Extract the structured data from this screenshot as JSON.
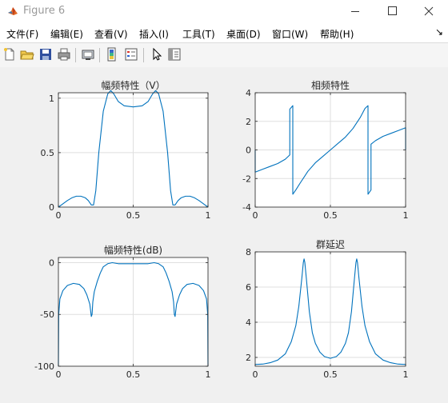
{
  "window": {
    "title": "Figure 6"
  },
  "menu": [
    "文件(F)",
    "编辑(E)",
    "查看(V)",
    "插入(I)",
    "工具(T)",
    "桌面(D)",
    "窗口(W)",
    "帮助(H)"
  ],
  "toolbar": {
    "icons": [
      "new-figure-icon",
      "open-file-icon",
      "save-icon",
      "print-icon",
      "link-plot-icon",
      "insert-colorbar-icon",
      "insert-legend-icon",
      "pointer-icon",
      "property-editor-icon"
    ]
  },
  "colors": {
    "line": "#0072bd",
    "grid": "#dfdfdf",
    "axes": "#262626"
  },
  "chart_data": [
    {
      "type": "line",
      "title": "幅频特性（V）",
      "xlim": [
        0,
        1
      ],
      "ylim": [
        0,
        1.05
      ],
      "xticks": [
        0,
        0.5,
        1
      ],
      "xtick_labels": [
        "0",
        "0.5",
        "1"
      ],
      "yticks": [
        0,
        0.5,
        1
      ],
      "ytick_labels": [
        "0",
        "0.5",
        "1"
      ],
      "grid": true,
      "x": [
        0,
        0.03,
        0.06,
        0.09,
        0.12,
        0.15,
        0.18,
        0.2,
        0.22,
        0.235,
        0.25,
        0.27,
        0.3,
        0.33,
        0.35,
        0.37,
        0.4,
        0.44,
        0.5,
        0.56,
        0.6,
        0.63,
        0.65,
        0.67,
        0.7,
        0.73,
        0.75,
        0.765,
        0.78,
        0.8,
        0.82,
        0.85,
        0.88,
        0.91,
        0.94,
        0.97,
        1
      ],
      "y": [
        0,
        0.03,
        0.06,
        0.085,
        0.1,
        0.1,
        0.085,
        0.06,
        0.02,
        0.02,
        0.15,
        0.5,
        0.88,
        1.04,
        1.07,
        1.04,
        0.97,
        0.93,
        0.92,
        0.93,
        0.97,
        1.04,
        1.07,
        1.04,
        0.88,
        0.5,
        0.15,
        0.02,
        0.02,
        0.06,
        0.085,
        0.1,
        0.1,
        0.085,
        0.06,
        0.03,
        0
      ]
    },
    {
      "type": "line",
      "title": "相频特性",
      "xlim": [
        0,
        1
      ],
      "ylim": [
        -4,
        4
      ],
      "xticks": [
        0,
        0.5,
        1
      ],
      "xtick_labels": [
        "0",
        "0.5",
        "1"
      ],
      "yticks": [
        -4,
        -2,
        0,
        2,
        4
      ],
      "ytick_labels": [
        "-4",
        "-2",
        "0",
        "2",
        "4"
      ],
      "grid": true,
      "x": [
        0,
        0.0001,
        0.05,
        0.1,
        0.15,
        0.2,
        0.23,
        0.23,
        0.25,
        0.25,
        0.27,
        0.3,
        0.35,
        0.4,
        0.45,
        0.5,
        0.55,
        0.6,
        0.65,
        0.7,
        0.73,
        0.75,
        0.75,
        0.77,
        0.77,
        0.8,
        0.85,
        0.9,
        0.95,
        1,
        1
      ],
      "y": [
        0,
        -1.55,
        -1.35,
        -1.15,
        -0.95,
        -0.65,
        -0.35,
        2.85,
        3.1,
        -3.1,
        -2.8,
        -2.3,
        -1.5,
        -0.9,
        -0.45,
        0,
        0.45,
        0.9,
        1.5,
        2.3,
        2.9,
        3.1,
        -3.1,
        -2.8,
        0.4,
        0.65,
        0.95,
        1.15,
        1.35,
        1.55,
        0
      ]
    },
    {
      "type": "line",
      "title": "幅频特性(dB)",
      "xlim": [
        0,
        1
      ],
      "ylim": [
        -100,
        5
      ],
      "xticks": [
        0,
        0.5,
        1
      ],
      "xtick_labels": [
        "0",
        "0.5",
        "1"
      ],
      "yticks": [
        -100,
        -50,
        0
      ],
      "ytick_labels": [
        "-100",
        "-50",
        "0"
      ],
      "grid": true,
      "x": [
        0,
        0.002,
        0.01,
        0.03,
        0.06,
        0.1,
        0.14,
        0.17,
        0.19,
        0.21,
        0.22,
        0.225,
        0.23,
        0.24,
        0.26,
        0.28,
        0.3,
        0.33,
        0.36,
        0.4,
        0.45,
        0.5,
        0.55,
        0.6,
        0.64,
        0.67,
        0.7,
        0.72,
        0.74,
        0.76,
        0.77,
        0.775,
        0.78,
        0.79,
        0.81,
        0.83,
        0.86,
        0.9,
        0.94,
        0.97,
        0.99,
        0.998,
        1
      ],
      "y": [
        -100,
        -50,
        -35,
        -27,
        -22,
        -20,
        -21,
        -25,
        -31,
        -40,
        -52,
        -50,
        -38,
        -28,
        -18,
        -10,
        -4,
        -1,
        0,
        -1,
        -1,
        -1,
        -1,
        -1,
        0,
        -1,
        -4,
        -10,
        -18,
        -28,
        -38,
        -50,
        -52,
        -40,
        -31,
        -25,
        -21,
        -20,
        -22,
        -27,
        -35,
        -50,
        -100
      ]
    },
    {
      "type": "line",
      "title": "群延迟",
      "xlim": [
        0,
        1
      ],
      "ylim": [
        1.5,
        8
      ],
      "xticks": [
        0,
        0.5,
        1
      ],
      "xtick_labels": [
        "0",
        "0.5",
        "1"
      ],
      "yticks": [
        2,
        4,
        6,
        8
      ],
      "ytick_labels": [
        "2",
        "4",
        "6",
        "8"
      ],
      "grid": true,
      "x": [
        0,
        0.05,
        0.1,
        0.15,
        0.2,
        0.24,
        0.27,
        0.29,
        0.31,
        0.32,
        0.325,
        0.33,
        0.34,
        0.36,
        0.38,
        0.4,
        0.43,
        0.46,
        0.5,
        0.54,
        0.57,
        0.6,
        0.62,
        0.64,
        0.66,
        0.67,
        0.675,
        0.68,
        0.69,
        0.71,
        0.73,
        0.76,
        0.8,
        0.85,
        0.9,
        0.95,
        1
      ],
      "y": [
        1.6,
        1.62,
        1.7,
        1.85,
        2.2,
        2.9,
        3.8,
        4.9,
        6.5,
        7.4,
        7.6,
        7.4,
        6.5,
        4.6,
        3.4,
        2.8,
        2.3,
        2.05,
        1.95,
        2.05,
        2.3,
        2.8,
        3.4,
        4.6,
        6.5,
        7.4,
        7.6,
        7.4,
        6.5,
        4.9,
        3.8,
        2.9,
        2.2,
        1.85,
        1.7,
        1.62,
        1.6
      ]
    }
  ]
}
